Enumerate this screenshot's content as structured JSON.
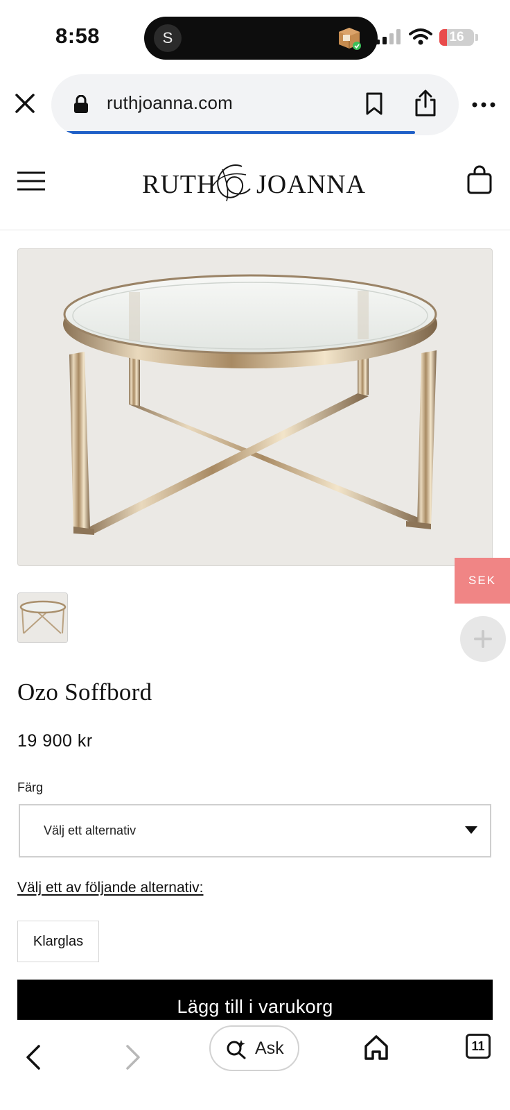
{
  "status_bar": {
    "time": "8:58",
    "island_avatar": "S",
    "battery_level": "16",
    "icons": [
      "signal-bars-icon",
      "wifi-icon",
      "battery-icon",
      "package-icon"
    ]
  },
  "browser": {
    "url": "ruthjoanna.com",
    "load_progress": 0.91,
    "icons": [
      "close-icon",
      "lock-icon",
      "bookmark-icon",
      "share-icon",
      "more-icon"
    ]
  },
  "site": {
    "logo_left": "RUTH",
    "logo_right": "JOANNA",
    "icons": [
      "hamburger-menu-icon",
      "shopping-bag-icon"
    ]
  },
  "overlay": {
    "currency": "SEK",
    "plus_icon": "plus-icon"
  },
  "product": {
    "title": "Ozo Soffbord",
    "price": "19 900 kr",
    "option_label": "Färg",
    "select_placeholder": "Välj ett alternativ",
    "alternatives_link": "Välj ett av följande alternativ:",
    "swatch": "Klarglas",
    "add_to_cart": "Lägg till i varukorg"
  },
  "toolbar": {
    "ask_label": "Ask",
    "tab_count": "11",
    "icons": [
      "back-arrow-icon",
      "forward-arrow-icon",
      "ask-sparkle-search-icon",
      "home-icon",
      "tabs-icon"
    ]
  },
  "colors": {
    "accent_blue": "#1f5fc7",
    "currency_tab": "#f08585",
    "cart_button": "#000000",
    "image_bg": "#ebe9e5"
  }
}
